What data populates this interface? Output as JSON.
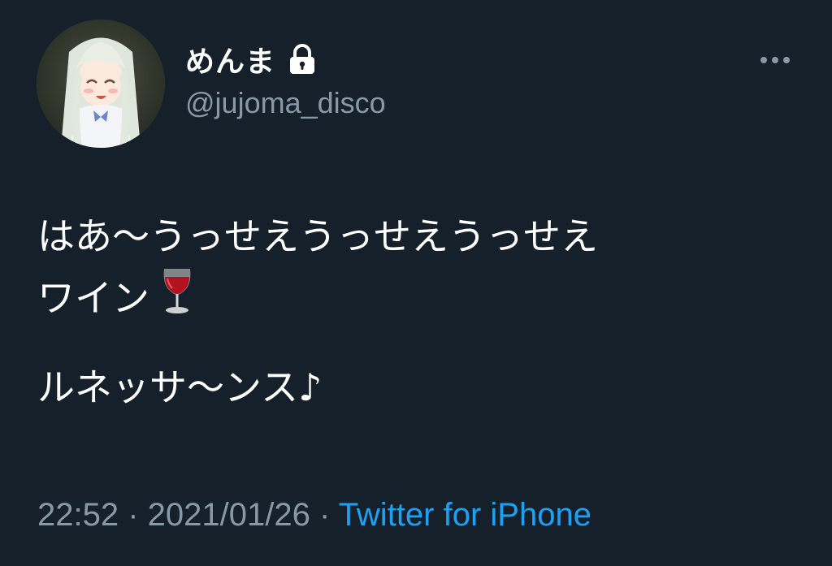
{
  "user": {
    "display_name": "めんま",
    "handle": "@jujoma_disco",
    "protected_icon": "lock-icon",
    "avatar_icon": "anime-girl-avatar"
  },
  "tweet": {
    "line1": "はあ〜うっせえうっせえうっせえ",
    "line2": "ワイン",
    "line2_emoji": "wine-glass-icon",
    "line3": "ルネッサ〜ンス♪"
  },
  "meta": {
    "time": "22:52",
    "sep1": " · ",
    "date": "2021/01/26",
    "sep2": " · ",
    "source": "Twitter for iPhone"
  },
  "colors": {
    "background": "#15202b",
    "text": "#ffffff",
    "secondary": "#8899a6",
    "link": "#1da1f2"
  }
}
